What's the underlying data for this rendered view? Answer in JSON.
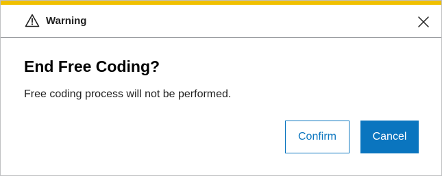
{
  "dialog": {
    "header": {
      "icon": "warning-triangle-icon",
      "title": "Warning",
      "close_icon": "close-icon"
    },
    "title": "End Free Coding?",
    "message": "Free coding process will not be performed.",
    "buttons": {
      "confirm_label": "Confirm",
      "cancel_label": "Cancel"
    }
  },
  "colors": {
    "accent_bar": "#f0c000",
    "primary": "#0a75bf",
    "text": "#1f1f1f"
  }
}
